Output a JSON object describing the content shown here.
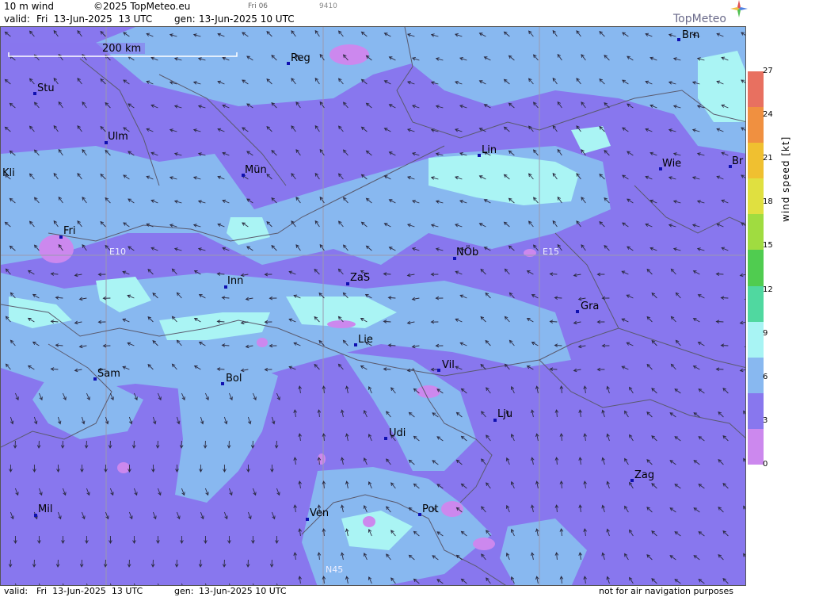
{
  "header": {
    "product": "10 m wind",
    "copyright": "©2025 TopMeteo.eu",
    "small_day": "Fri 06",
    "small_code": "9410",
    "valid_label": "valid:",
    "valid_value": "Fri  13-Jun-2025  13 UTC",
    "gen_label": "gen:",
    "gen_value": "13-Jun-2025 10 UTC",
    "brand": "TopMeteo"
  },
  "map": {
    "scale_label": "200 km",
    "grid_labels": [
      "E10",
      "E15",
      "N45"
    ],
    "cities": [
      "Brn",
      "Reg",
      "Stu",
      "Ulm",
      "Kli",
      "Mün",
      "Lin",
      "Wie",
      "Br",
      "Fri",
      "NÖb",
      "Inn",
      "ZaS",
      "Gra",
      "Lie",
      "Vil",
      "Sam",
      "Bol",
      "Lju",
      "Udi",
      "Zag",
      "Mil",
      "Ven",
      "Pot"
    ],
    "colors": {
      "calm": "#cc88ee",
      "light": "#8877ee",
      "moderate": "#88b8f0",
      "fresh": "#aaf4f4"
    }
  },
  "legend": {
    "title": "wind speed  [kt]",
    "ticks": [
      "27",
      "24",
      "21",
      "18",
      "15",
      "12",
      "9",
      "6",
      "3",
      "0"
    ],
    "colors": [
      "#e87060",
      "#f09040",
      "#f0c030",
      "#e0e040",
      "#a0dc40",
      "#50cc50",
      "#50d8a0",
      "#a8f4f4",
      "#88b8f0",
      "#8877ee",
      "#cc88ee"
    ]
  },
  "footer": {
    "valid_label": "valid:",
    "valid_value": "Fri  13-Jun-2025  13 UTC",
    "gen_label": "gen:",
    "gen_value": "13-Jun-2025 10 UTC",
    "disclaimer": "not for air navigation purposes"
  }
}
